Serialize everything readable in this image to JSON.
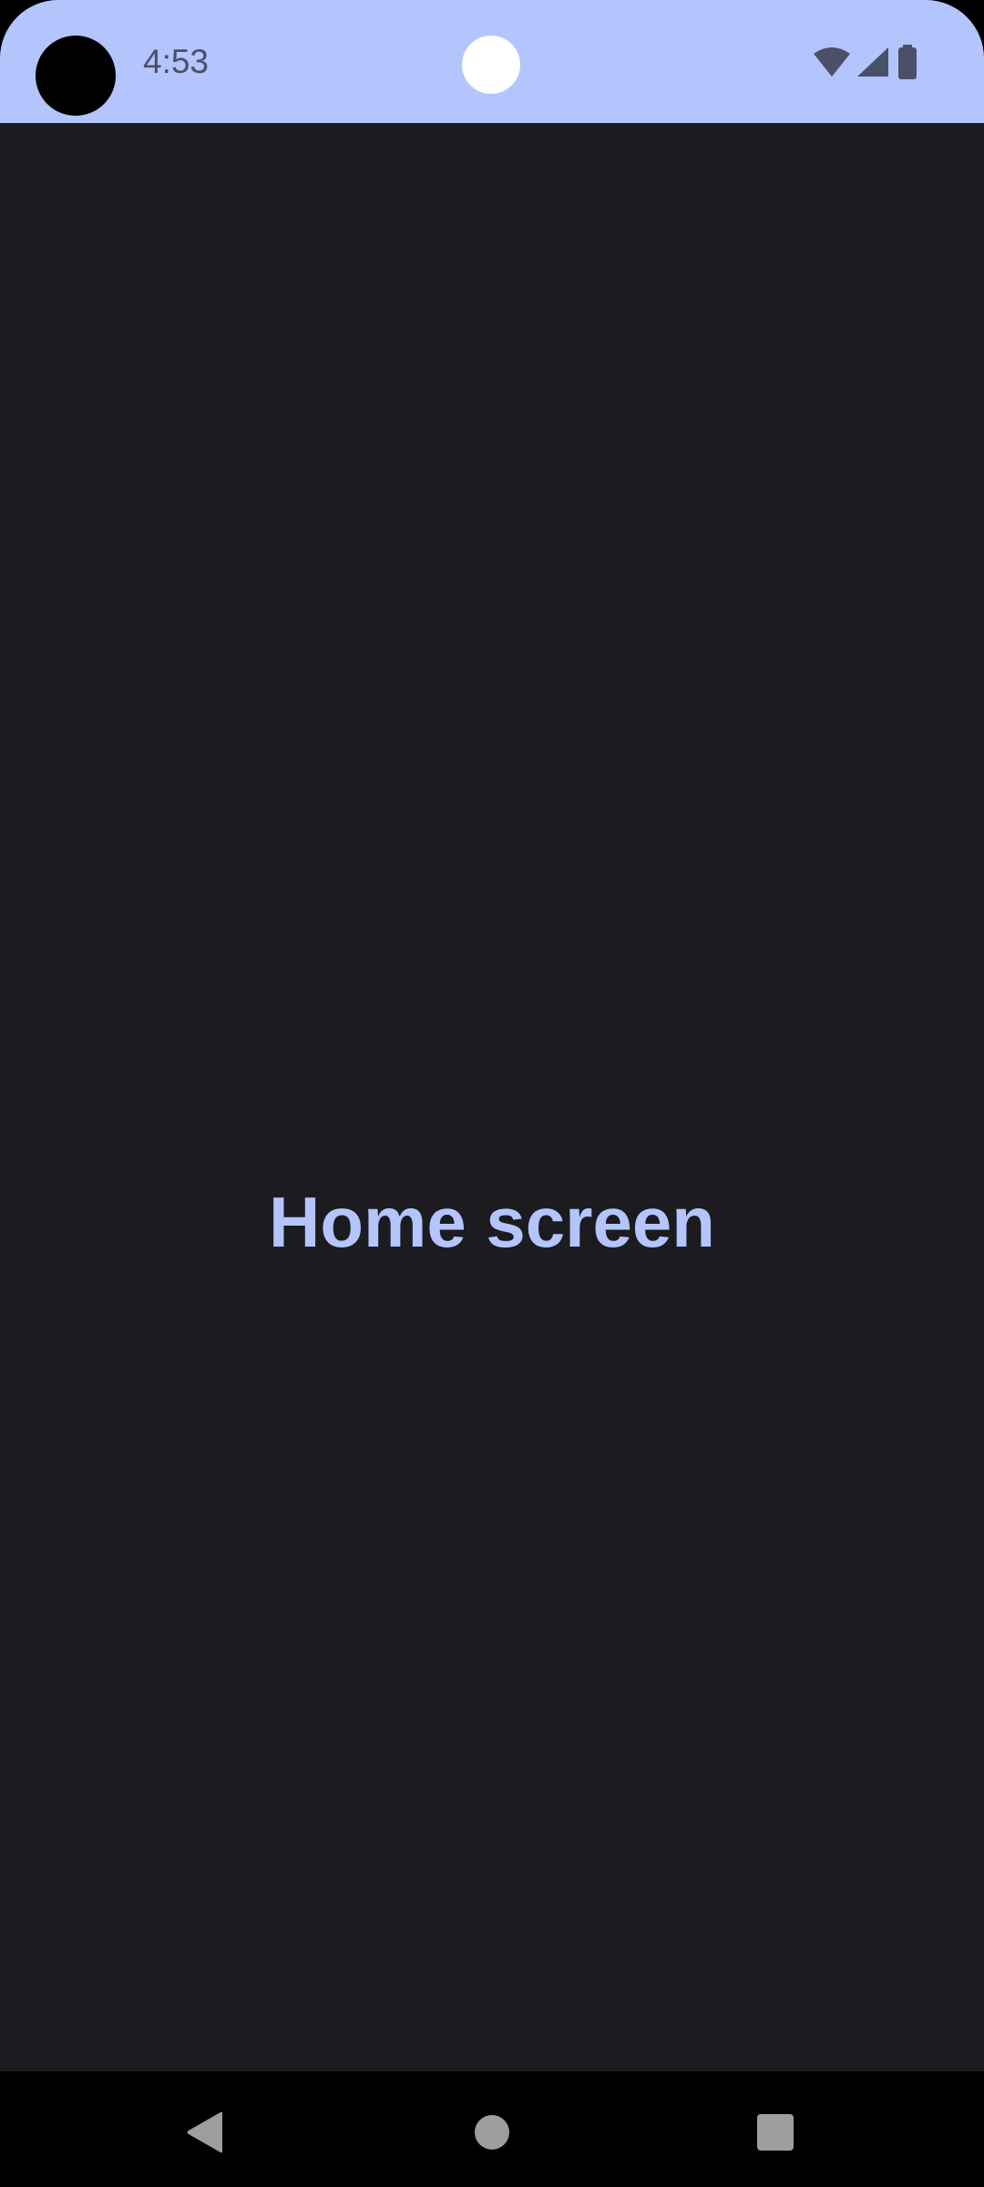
{
  "status_bar": {
    "time": "4:53",
    "icons": [
      "wifi-icon",
      "cellular-signal-icon",
      "battery-icon"
    ],
    "background_color": "#b3c5fc"
  },
  "main": {
    "title": "Home screen",
    "background_color": "#1c1b20",
    "title_color": "#b3c5fc"
  },
  "navigation_bar": {
    "buttons": [
      "back-icon",
      "home-icon",
      "recents-icon"
    ]
  }
}
